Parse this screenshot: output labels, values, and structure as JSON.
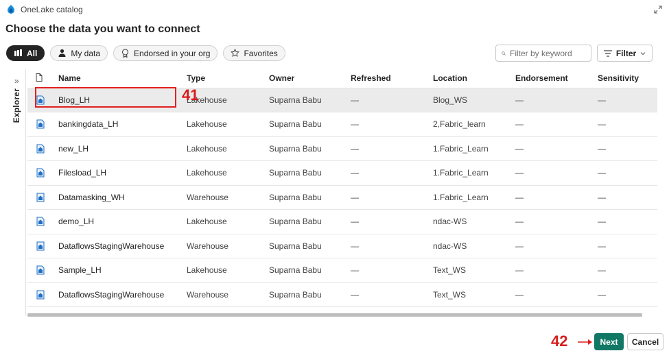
{
  "window": {
    "title": "OneLake catalog"
  },
  "header": {
    "title": "Choose the data you want to connect"
  },
  "filters": {
    "pills": [
      {
        "label": "All",
        "icon": "grid-icon",
        "active": true
      },
      {
        "label": "My data",
        "icon": "person-icon",
        "active": false
      },
      {
        "label": "Endorsed in your org",
        "icon": "ribbon-icon",
        "active": false
      },
      {
        "label": "Favorites",
        "icon": "star-icon",
        "active": false
      }
    ],
    "search_placeholder": "Filter by keyword",
    "filter_label": "Filter"
  },
  "explorer": {
    "label": "Explorer"
  },
  "table": {
    "columns": [
      "Name",
      "Type",
      "Owner",
      "Refreshed",
      "Location",
      "Endorsement",
      "Sensitivity"
    ],
    "rows": [
      {
        "name": "Blog_LH",
        "type": "Lakehouse",
        "owner": "Suparna Babu",
        "refreshed": "—",
        "location": "Blog_WS",
        "endorsement": "—",
        "sensitivity": "—",
        "selected": true
      },
      {
        "name": "bankingdata_LH",
        "type": "Lakehouse",
        "owner": "Suparna Babu",
        "refreshed": "—",
        "location": "2,Fabric_learn",
        "endorsement": "—",
        "sensitivity": "—",
        "selected": false
      },
      {
        "name": "new_LH",
        "type": "Lakehouse",
        "owner": "Suparna Babu",
        "refreshed": "—",
        "location": "1.Fabric_Learn",
        "endorsement": "—",
        "sensitivity": "—",
        "selected": false
      },
      {
        "name": "Filesload_LH",
        "type": "Lakehouse",
        "owner": "Suparna Babu",
        "refreshed": "—",
        "location": "1.Fabric_Learn",
        "endorsement": "—",
        "sensitivity": "—",
        "selected": false
      },
      {
        "name": "Datamasking_WH",
        "type": "Warehouse",
        "owner": "Suparna Babu",
        "refreshed": "—",
        "location": "1.Fabric_Learn",
        "endorsement": "—",
        "sensitivity": "—",
        "selected": false
      },
      {
        "name": "demo_LH",
        "type": "Lakehouse",
        "owner": "Suparna Babu",
        "refreshed": "—",
        "location": "ndac-WS",
        "endorsement": "—",
        "sensitivity": "—",
        "selected": false
      },
      {
        "name": "DataflowsStagingWarehouse",
        "type": "Warehouse",
        "owner": "Suparna Babu",
        "refreshed": "—",
        "location": "ndac-WS",
        "endorsement": "—",
        "sensitivity": "—",
        "selected": false
      },
      {
        "name": "Sample_LH",
        "type": "Lakehouse",
        "owner": "Suparna Babu",
        "refreshed": "—",
        "location": "Text_WS",
        "endorsement": "—",
        "sensitivity": "—",
        "selected": false
      },
      {
        "name": "DataflowsStagingWarehouse",
        "type": "Warehouse",
        "owner": "Suparna Babu",
        "refreshed": "—",
        "location": "Text_WS",
        "endorsement": "—",
        "sensitivity": "—",
        "selected": false
      }
    ]
  },
  "annotations": {
    "step1": "41",
    "step2": "42",
    "color": "#d91c1c"
  },
  "footer": {
    "next_label": "Next",
    "cancel_label": "Cancel"
  },
  "colors": {
    "primary": "#117865",
    "selected_row": "#ebebeb",
    "lakehouse_icon": "#1f6fc4"
  }
}
